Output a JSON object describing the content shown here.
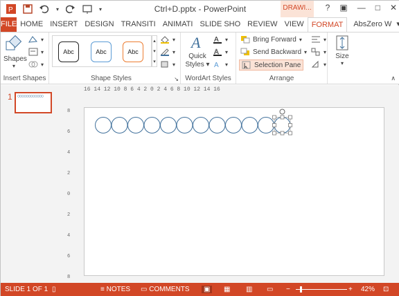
{
  "window": {
    "title": "Ctrl+D.pptx - PowerPoint",
    "contextual_tab": "DRAWI...",
    "controls": [
      "?",
      "restore",
      "minimize",
      "maximize",
      "close"
    ]
  },
  "tabs": {
    "file": "FILE",
    "items": [
      "HOME",
      "INSERT",
      "DESIGN",
      "TRANSITI",
      "ANIMATI",
      "SLIDE SHO",
      "REVIEW",
      "VIEW",
      "FORMAT"
    ],
    "active": "FORMAT",
    "user": "AbsZero W"
  },
  "ribbon": {
    "insert_shapes": {
      "shapes_label": "Shapes",
      "group_label": "Insert Shapes"
    },
    "shape_styles": {
      "samples": [
        "Abc",
        "Abc",
        "Abc"
      ],
      "group_label": "Shape Styles"
    },
    "wordart": {
      "quick_styles_label": "Quick Styles",
      "group_label": "WordArt Styles"
    },
    "arrange": {
      "bring_forward": "Bring Forward",
      "send_backward": "Send Backward",
      "selection_pane": "Selection Pane",
      "group_label": "Arrange"
    },
    "size": {
      "label": "Size"
    }
  },
  "thumbnails": {
    "number": "1"
  },
  "ruler": {
    "horizontal": "16 14 12 10 8 6 4 2 0 2 4 6 8 10 12 14 16",
    "vertical": [
      "8",
      "6",
      "4",
      "2",
      "0",
      "2",
      "4",
      "6",
      "8"
    ]
  },
  "slide": {
    "circle_count": 12,
    "selected_index": 11
  },
  "statusbar": {
    "slide_info": "SLIDE 1 OF 1",
    "notes": "NOTES",
    "comments": "COMMENTS",
    "zoom": "42%"
  },
  "colors": {
    "accent": "#d24726",
    "circle_stroke": "#41719c"
  }
}
